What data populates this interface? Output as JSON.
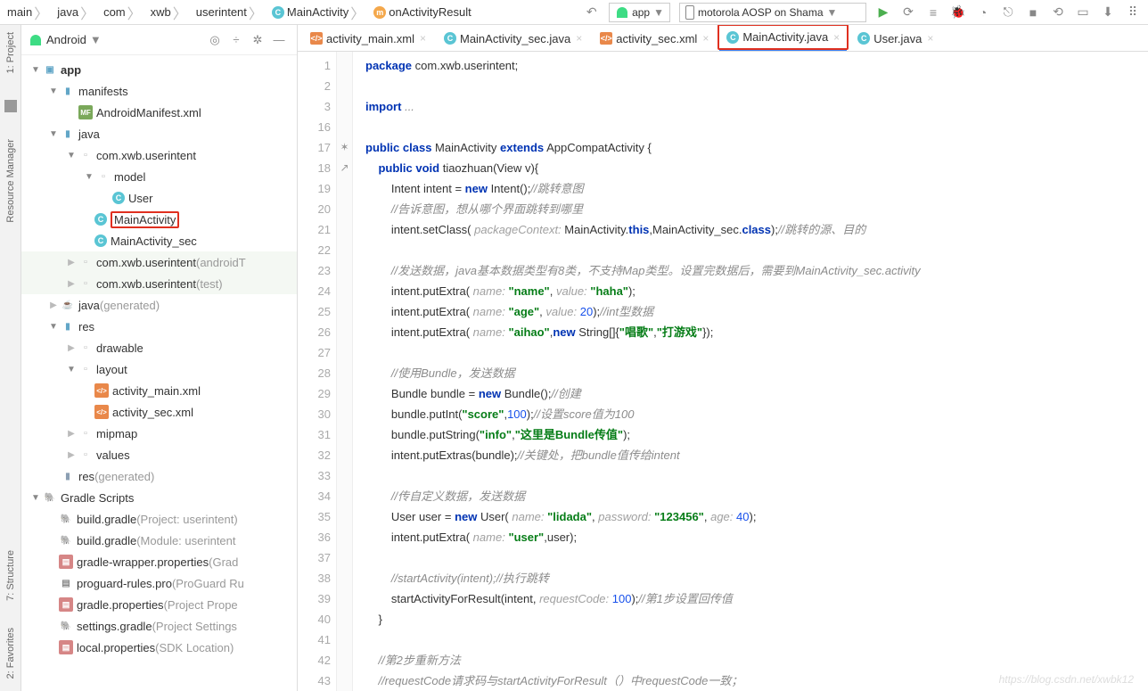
{
  "breadcrumb": [
    "main",
    "java",
    "com",
    "xwb",
    "userintent",
    "MainActivity",
    "onActivityResult"
  ],
  "run_config": "app",
  "device": "motorola AOSP on Shama",
  "sidebar": {
    "selector": "Android"
  },
  "tree": {
    "app": "app",
    "manifests": "manifests",
    "manifest_file": "AndroidManifest.xml",
    "java": "java",
    "pkg1": "com.xwb.userintent",
    "model": "model",
    "user": "User",
    "main_activity": "MainActivity",
    "main_sec": "MainActivity_sec",
    "pkg2": "com.xwb.userintent",
    "pkg2_suffix": " (androidT",
    "pkg3": "com.xwb.userintent",
    "pkg3_suffix": " (test)",
    "java_gen": "java",
    "java_gen_suffix": " (generated)",
    "res": "res",
    "drawable": "drawable",
    "layout": "layout",
    "layout1": "activity_main.xml",
    "layout2": "activity_sec.xml",
    "mipmap": "mipmap",
    "values": "values",
    "res_gen": "res",
    "res_gen_suffix": " (generated)",
    "gradle": "Gradle Scripts",
    "bg1": "build.gradle",
    "bg1s": " (Project: userintent)",
    "bg2": "build.gradle",
    "bg2s": " (Module: userintent",
    "gw": "gradle-wrapper.properties",
    "gws": " (Grad",
    "pg": "proguard-rules.pro",
    "pgs": " (ProGuard Ru",
    "gp": "gradle.properties",
    "gps": " (Project Prope",
    "sg": "settings.gradle",
    "sgs": " (Project Settings",
    "lp": "local.properties",
    "lps": " (SDK Location)"
  },
  "tabs": [
    {
      "label": "activity_main.xml",
      "type": "xml"
    },
    {
      "label": "MainActivity_sec.java",
      "type": "c"
    },
    {
      "label": "activity_sec.xml",
      "type": "xml"
    },
    {
      "label": "MainActivity.java",
      "type": "c",
      "active": true,
      "highlight": true
    },
    {
      "label": "User.java",
      "type": "c"
    }
  ],
  "line_numbers": [
    "1",
    "2",
    "3",
    "16",
    "17",
    "18",
    "19",
    "20",
    "21",
    "22",
    "23",
    "24",
    "25",
    "26",
    "27",
    "28",
    "29",
    "30",
    "31",
    "32",
    "33",
    "34",
    "35",
    "36",
    "37",
    "38",
    "39",
    "40",
    "41",
    "42",
    "43"
  ],
  "left_tools": [
    "1: Project",
    "Resource Manager",
    "7: Structure",
    "2: Favorites"
  ],
  "watermark": "https://blog.csdn.net/xwbk12"
}
